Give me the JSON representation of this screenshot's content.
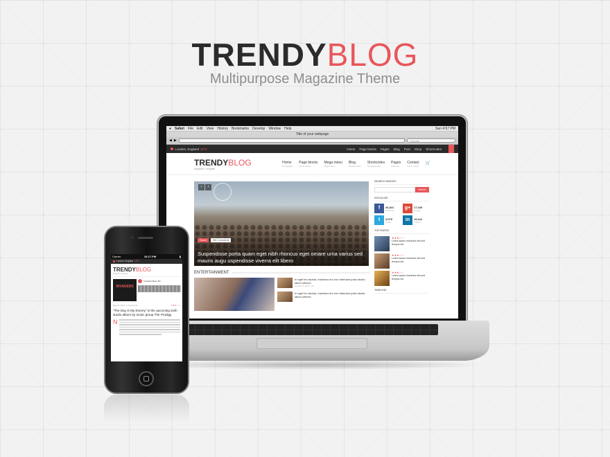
{
  "header": {
    "brand_part1": "TRENDY",
    "brand_part2": "BLOG",
    "tagline": "Multipurpose Magazine Theme"
  },
  "colors": {
    "accent": "#e8565a",
    "dark": "#2b2b2b"
  },
  "mac": {
    "menu": [
      "Safari",
      "File",
      "Edit",
      "View",
      "History",
      "Bookmarks",
      "Develop",
      "Window",
      "Help"
    ],
    "clock": "Sun 4:57 PM",
    "window_title": "Title of your webpage",
    "search_placeholder": "Google"
  },
  "site": {
    "location": "London, England",
    "temperature": "18°C",
    "top_links": [
      "Home",
      "Page blocks",
      "Pages",
      "Blog",
      "Post",
      "Shop",
      "Shortcodes"
    ],
    "logo_part1": "TRENDY",
    "logo_part2": "BLOG",
    "logo_sub": "Magazine Template",
    "nav": [
      {
        "label": "Home",
        "sub": "Frontpages"
      },
      {
        "label": "Page blocks",
        "sub": "Home blocks"
      },
      {
        "label": "Mega menu",
        "sub": "Mega menu"
      },
      {
        "label": "Blog",
        "sub": "Recent News"
      },
      {
        "label": "Shortcodes",
        "sub": "All Shortcodes"
      },
      {
        "label": "Pages",
        "sub": "Features"
      },
      {
        "label": "Contact",
        "sub": "Get in Touch"
      }
    ],
    "slider": {
      "category": "Travel",
      "comments": "256 Comments",
      "title": "Suspendisse porta quam eget nibh rhoncus eget omare urna varius sed mauris augu uspendisse viverra elit libero"
    },
    "entertainment": {
      "section_title": "ENTERTAINMENT",
      "items": [
        {
          "title": "In eget leo lacinia, maximus leo non interdum justo studio latum ultrices",
          "meta": "October 9, 2014  ·  28"
        },
        {
          "title": "In eget leo lacinia, maximus leo non interdum justo studio latum ultrices",
          "meta": ""
        }
      ]
    },
    "sidebar": {
      "search_title": "SEARCH WIDGET",
      "search_button": "Search",
      "socialize_title": "SOCIALIZE",
      "social": [
        {
          "icon": "facebook-icon",
          "glyph": "f",
          "count": "46,841",
          "label": "Facebook",
          "color": "#3b5998"
        },
        {
          "icon": "google-plus-icon",
          "glyph": "g+",
          "count": "17,045",
          "label": "Google+",
          "color": "#dd4b39"
        },
        {
          "icon": "twitter-icon",
          "glyph": "t",
          "count": "3,075",
          "label": "Twitter",
          "color": "#2aa9e0"
        },
        {
          "icon": "linkedin-icon",
          "glyph": "in",
          "count": "15,441",
          "label": "LinkedIn",
          "color": "#0e76a8"
        }
      ],
      "top_rated_title": "TOP RATED",
      "top_rated": [
        {
          "stars": "★★★☆☆",
          "title": "Lorem ipsum maximus nisl sed tempus est"
        },
        {
          "stars": "★★★☆☆",
          "title": "Lorem ipsum maximus nisl sed tempus est"
        },
        {
          "stars": "★★★☆☆",
          "title": "Lorem ipsum maximus nisl sed tempus est"
        }
      ],
      "timeline_title": "TIMELINE"
    }
  },
  "phone": {
    "carrier": "Carrier",
    "time": "10:17 PM",
    "location": "London, England",
    "temperature": "18°C",
    "logo_part1": "TRENDY",
    "logo_part2": "BLOG",
    "logo_sub": "Magazine Template",
    "album_text": "INVADERS",
    "track": "Trouble's Been Bri…",
    "meta_left": "May 15, 2014  ·  0 Comments",
    "meta_stars": "★★★☆☆",
    "post_title": "\"The Day Is My Enemy\" is the upcoming sixth studio album by music group The Prodigy",
    "drop_cap": "N"
  }
}
